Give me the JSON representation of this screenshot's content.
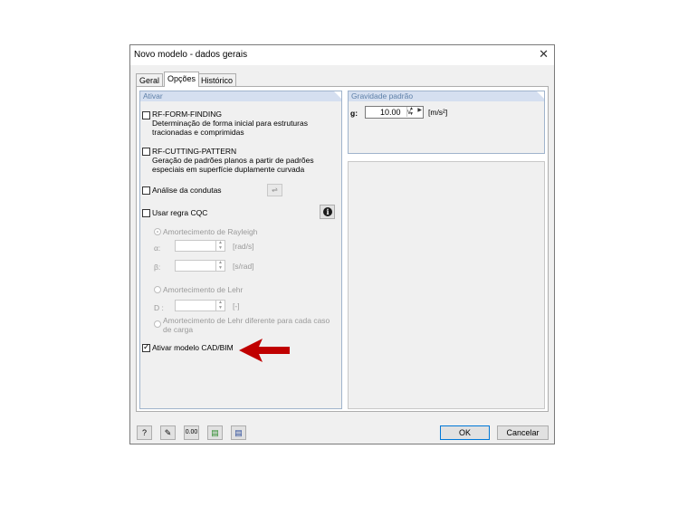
{
  "window": {
    "title": "Novo modelo - dados gerais"
  },
  "tabs": [
    {
      "label": "Geral"
    },
    {
      "label": "Opções"
    },
    {
      "label": "Histórico"
    }
  ],
  "ativar": {
    "header": "Ativar",
    "form_finding": {
      "title": "RF-FORM-FINDING",
      "desc_line1": "Determinação de forma inicial para estruturas",
      "desc_line2": "tracionadas e comprimidas",
      "checked": false
    },
    "cutting_pattern": {
      "title": "RF-CUTTING-PATTERN",
      "desc_line1": "Geração de padrões planos a partir de padrões",
      "desc_line2": "especiais em superfície duplamente curvada",
      "checked": false
    },
    "analise_condutas": {
      "label": "Análise da condutas",
      "checked": false
    },
    "regra_cqc": {
      "label": "Usar regra CQC",
      "checked": false
    },
    "rayleigh": {
      "label": "Amortecimento de Rayleigh",
      "alpha_label": "α:",
      "alpha_unit": "[rad/s]",
      "beta_label": "β:",
      "beta_unit": "[s/rad]"
    },
    "lehr": {
      "label": "Amortecimento de Lehr",
      "d_label": "D :",
      "d_unit": "[-]"
    },
    "lehr_diff": {
      "line1": "Amortecimento de Lehr diferente para cada caso",
      "line2": "de carga"
    },
    "cad_bim": {
      "label": "Ativar modelo CAD/BIM",
      "checked": true
    }
  },
  "gravidade": {
    "header": "Gravidade padrão",
    "g_label": "g:",
    "g_value": "10.00",
    "g_unit": "[m/s²]"
  },
  "footer": {
    "ok_label": "OK",
    "cancel_label": "Cancelar",
    "icons": [
      "help-icon",
      "edit-icon",
      "units-icon",
      "load-icon",
      "save-icon"
    ]
  },
  "colors": {
    "arrow": "#c00000",
    "group_header_bg": "#d5dff0",
    "group_header_text": "#5d7fa8",
    "accent": "#0078d7"
  }
}
